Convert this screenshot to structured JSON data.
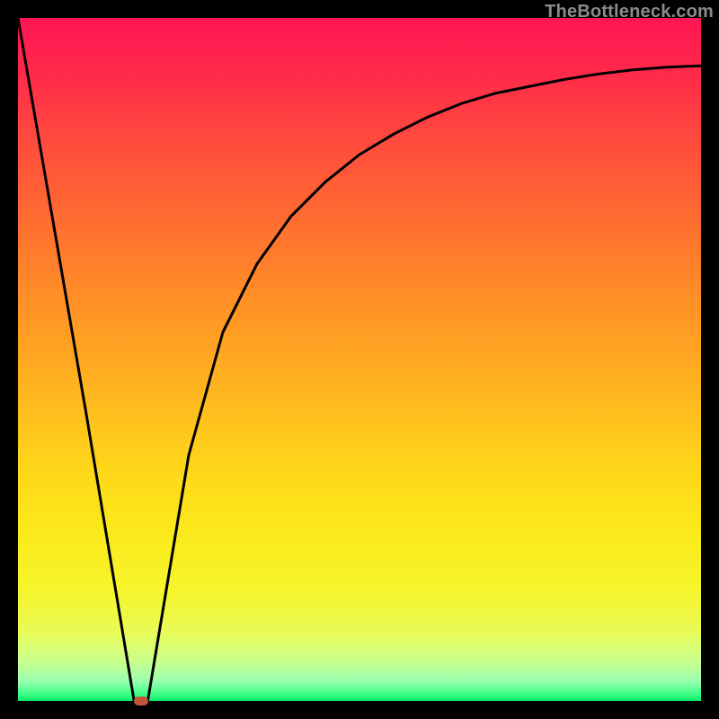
{
  "watermark": "TheBottleneck.com",
  "colors": {
    "frame": "#000000",
    "curve": "#000000",
    "marker": "#c1553e"
  },
  "chart_data": {
    "type": "line",
    "title": "",
    "xlabel": "",
    "ylabel": "",
    "xlim": [
      0,
      100
    ],
    "ylim": [
      0,
      100
    ],
    "grid": false,
    "x": [
      0,
      5,
      10,
      14,
      16,
      17,
      18,
      19,
      20,
      25,
      30,
      35,
      40,
      45,
      50,
      55,
      60,
      65,
      70,
      75,
      80,
      85,
      90,
      95,
      100
    ],
    "values": [
      100,
      71,
      42,
      18,
      6,
      0,
      0,
      0,
      6,
      36,
      54,
      64,
      71,
      76,
      80,
      83,
      85.5,
      87.5,
      89,
      90,
      91,
      91.8,
      92.4,
      92.8,
      93
    ],
    "marker": {
      "x": 18,
      "y": 0
    },
    "background_gradient": [
      "#ff1554",
      "#07e86a"
    ]
  }
}
